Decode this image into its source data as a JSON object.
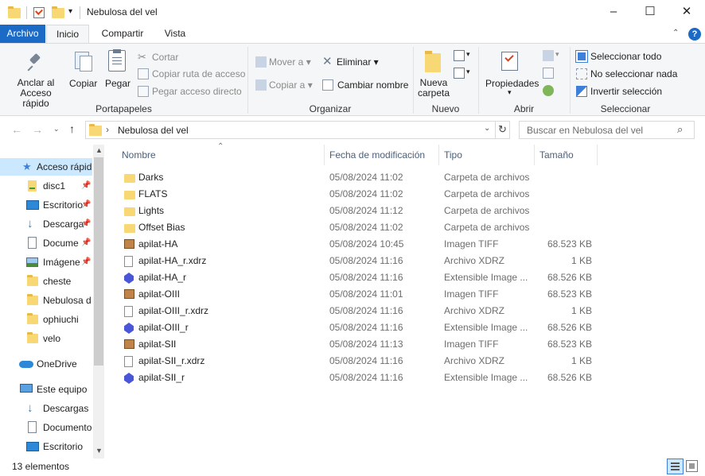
{
  "window": {
    "title": "Nebulosa del vel",
    "minimize": "–",
    "maximize": "☐",
    "close": "✕"
  },
  "menu": {
    "tabs": [
      "Archivo",
      "Inicio",
      "Compartir",
      "Vista"
    ],
    "help": "?"
  },
  "ribbon": {
    "portapapeles": {
      "pin": "Anclar al\nAcceso rápido",
      "copy": "Copiar",
      "paste": "Pegar",
      "cut": "Cortar",
      "copy_path": "Copiar ruta de acceso",
      "paste_shortcut": "Pegar acceso directo",
      "group": "Portapapeles"
    },
    "organizar": {
      "move": "Mover a",
      "copy_to": "Copiar a",
      "delete": "Eliminar",
      "rename": "Cambiar nombre",
      "group": "Organizar"
    },
    "nuevo": {
      "new_folder": "Nueva\ncarpeta",
      "group": "Nuevo"
    },
    "abrir": {
      "properties": "Propiedades",
      "group": "Abrir"
    },
    "seleccionar": {
      "select_all": "Seleccionar todo",
      "select_none": "No seleccionar nada",
      "invert": "Invertir selección",
      "group": "Seleccionar"
    }
  },
  "address": {
    "path": "Nebulosa del vel",
    "search_placeholder": "Buscar en Nebulosa del vel"
  },
  "nav": {
    "items": [
      {
        "label": "Acceso rápid",
        "icon": "star-icon"
      },
      {
        "label": "disc1",
        "icon": "drive-icon"
      },
      {
        "label": "Escritorio",
        "icon": "desktop-icon"
      },
      {
        "label": "Descarga",
        "icon": "download-icon"
      },
      {
        "label": "Docume",
        "icon": "documents-icon"
      },
      {
        "label": "Imágene",
        "icon": "pictures-icon"
      },
      {
        "label": "cheste",
        "icon": "folder-icon"
      },
      {
        "label": "Nebulosa d",
        "icon": "folder-icon"
      },
      {
        "label": "ophiuchi",
        "icon": "folder-icon"
      },
      {
        "label": "velo",
        "icon": "folder-icon"
      },
      {
        "label": "OneDrive",
        "icon": "cloud-icon"
      },
      {
        "label": "Este equipo",
        "icon": "computer-icon"
      },
      {
        "label": "Descargas",
        "icon": "download-icon"
      },
      {
        "label": "Documento",
        "icon": "documents-icon"
      },
      {
        "label": "Escritorio",
        "icon": "desktop-icon"
      }
    ]
  },
  "columns": {
    "name": "Nombre",
    "date": "Fecha de modificación",
    "type": "Tipo",
    "size": "Tamaño"
  },
  "files": [
    {
      "name": "Darks",
      "date": "05/08/2024 11:02",
      "type": "Carpeta de archivos",
      "size": "",
      "icon": "folder"
    },
    {
      "name": "FLATS",
      "date": "05/08/2024 11:02",
      "type": "Carpeta de archivos",
      "size": "",
      "icon": "folder"
    },
    {
      "name": "Lights",
      "date": "05/08/2024 11:12",
      "type": "Carpeta de archivos",
      "size": "",
      "icon": "folder"
    },
    {
      "name": "Offset Bias",
      "date": "05/08/2024 11:02",
      "type": "Carpeta de archivos",
      "size": "",
      "icon": "folder"
    },
    {
      "name": "apilat-HA",
      "date": "05/08/2024 10:45",
      "type": "Imagen TIFF",
      "size": "68.523 KB",
      "icon": "tiff"
    },
    {
      "name": "apilat-HA_r.xdrz",
      "date": "05/08/2024 11:16",
      "type": "Archivo XDRZ",
      "size": "1 KB",
      "icon": "file"
    },
    {
      "name": "apilat-HA_r",
      "date": "05/08/2024 11:16",
      "type": "Extensible Image ...",
      "size": "68.526 KB",
      "icon": "xisf"
    },
    {
      "name": "apilat-OIII",
      "date": "05/08/2024 11:01",
      "type": "Imagen TIFF",
      "size": "68.523 KB",
      "icon": "tiff"
    },
    {
      "name": "apilat-OIII_r.xdrz",
      "date": "05/08/2024 11:16",
      "type": "Archivo XDRZ",
      "size": "1 KB",
      "icon": "file"
    },
    {
      "name": "apilat-OIII_r",
      "date": "05/08/2024 11:16",
      "type": "Extensible Image ...",
      "size": "68.526 KB",
      "icon": "xisf"
    },
    {
      "name": "apilat-SII",
      "date": "05/08/2024 11:13",
      "type": "Imagen TIFF",
      "size": "68.523 KB",
      "icon": "tiff"
    },
    {
      "name": "apilat-SII_r.xdrz",
      "date": "05/08/2024 11:16",
      "type": "Archivo XDRZ",
      "size": "1 KB",
      "icon": "file"
    },
    {
      "name": "apilat-SII_r",
      "date": "05/08/2024 11:16",
      "type": "Extensible Image ...",
      "size": "68.526 KB",
      "icon": "xisf"
    }
  ],
  "status": {
    "count": "13 elementos"
  },
  "colors": {
    "accent": "#1a6ac6",
    "folder": "#f8d775",
    "selected_nav": "#cce8ff"
  }
}
